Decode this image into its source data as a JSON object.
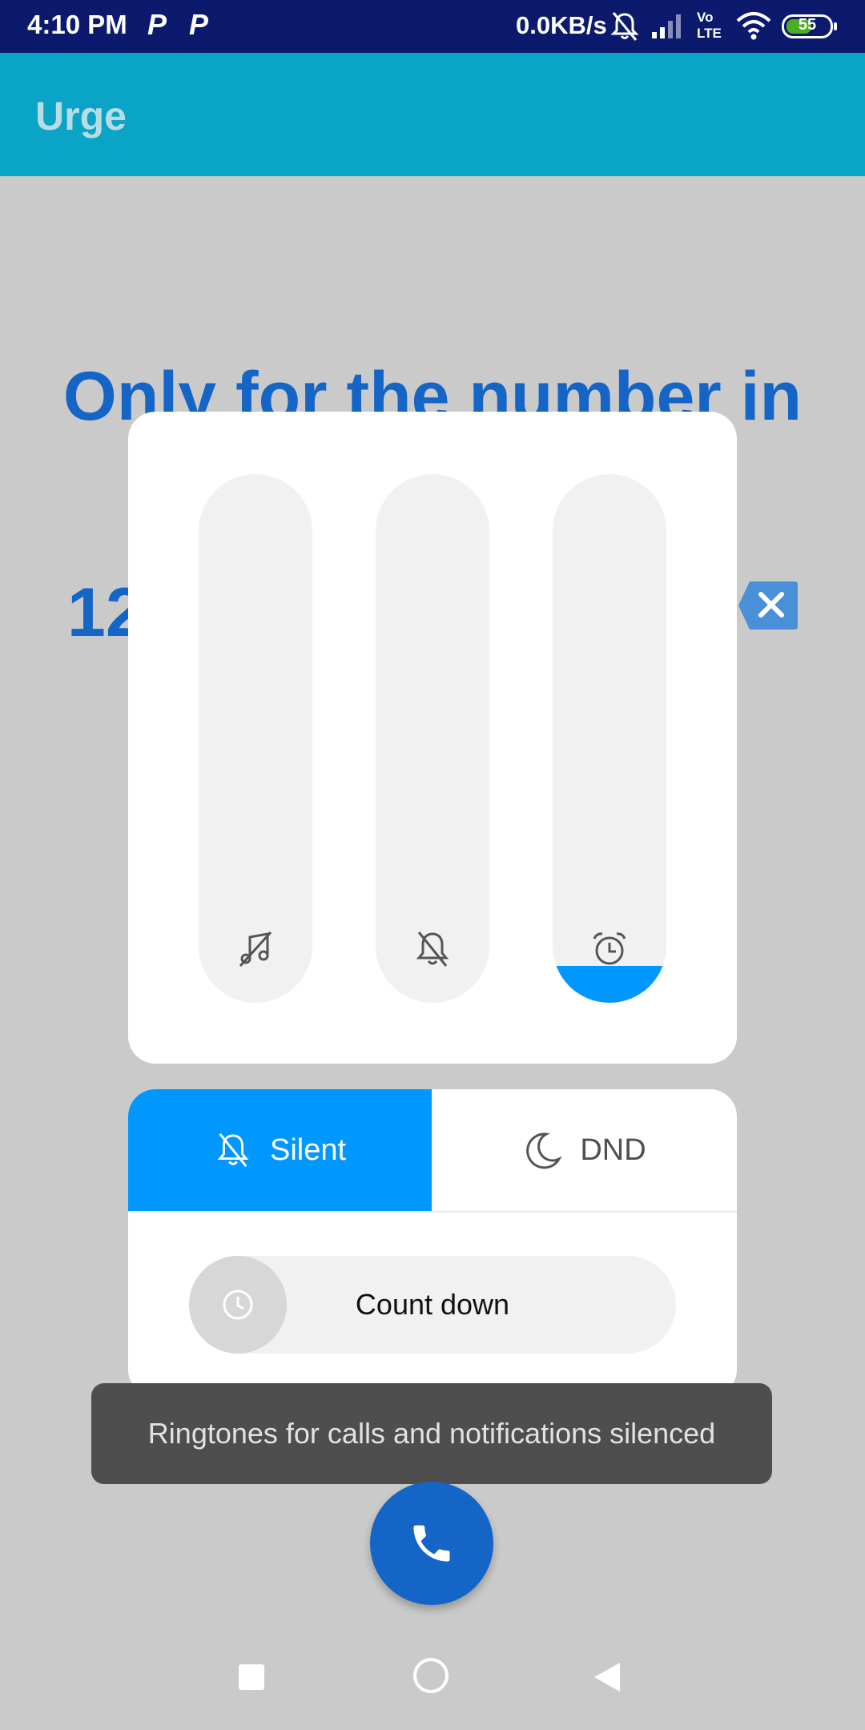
{
  "status_bar": {
    "time": "4:10 PM",
    "notification_icons": [
      "P",
      "P"
    ],
    "net_speed": "0.0KB/s",
    "volte": "Vo",
    "lte": "LTE",
    "battery_level": "55",
    "icons": [
      "muted-bell-icon",
      "signal-icon",
      "volte-icon",
      "wifi-icon",
      "battery-icon"
    ]
  },
  "app_bar": {
    "title": "Urge"
  },
  "background": {
    "heading": "Only for the number in",
    "number_partial": "12"
  },
  "volume_panel": {
    "sliders": [
      {
        "icon": "music-muted-icon",
        "level": 0
      },
      {
        "icon": "bell-muted-icon",
        "level": 0
      },
      {
        "icon": "alarm-clock-icon",
        "level": 0.07
      }
    ],
    "accent": "#0097ff"
  },
  "mode_panel": {
    "silent_label": "Silent",
    "dnd_label": "DND",
    "silent_active": true,
    "countdown_label": "Count down"
  },
  "toast": {
    "message": "Ringtones for calls and notifications silenced"
  },
  "colors": {
    "status_bar": "#0c1a6e",
    "app_bar": "#0aa4c6",
    "primary_blue": "#1565c7",
    "accent": "#0097ff"
  }
}
